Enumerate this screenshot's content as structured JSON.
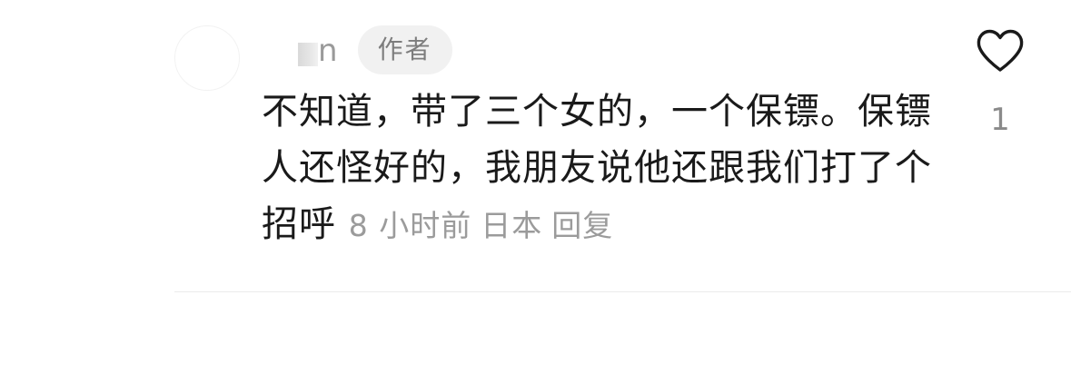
{
  "comment": {
    "username_visible": "n",
    "author_badge": "作者",
    "text": "不知道，带了三个女的，一个保镖。保镖人还怪好的，我朋友说他还跟我们打了个招呼",
    "time": "8 小时前",
    "location": "日本",
    "reply_label": "回复",
    "like_count": "1",
    "like_icon": "heart-outline-icon"
  },
  "colors": {
    "text": "#1a1a1a",
    "meta": "#9b9b9b",
    "badge_bg": "#f1f1f1",
    "badge_text": "#7d7d7d",
    "divider": "#ebebeb"
  }
}
